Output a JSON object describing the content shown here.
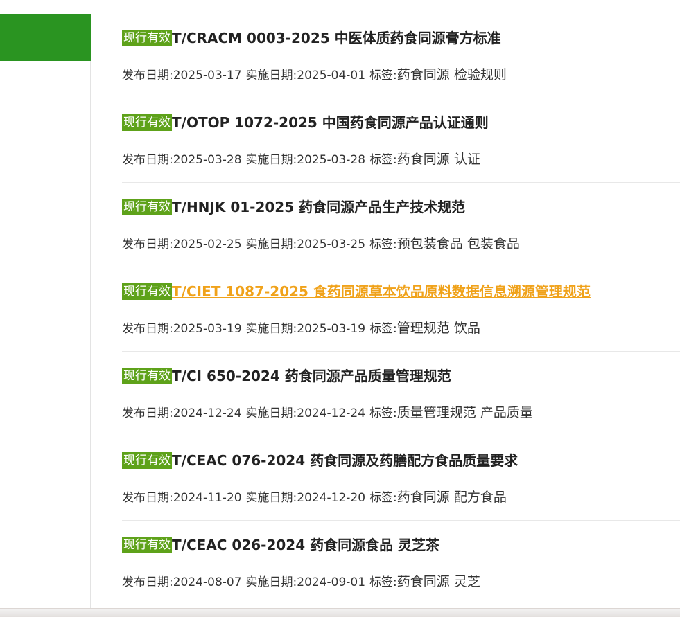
{
  "badge_label": "现行有效",
  "items": [
    {
      "title": "T/CRACM 0003-2025 中医体质药食同源膏方标准",
      "publish_label": "发布日期:",
      "publish_date": "2025-03-17",
      "impl_label": "实施日期:",
      "impl_date": "2025-04-01",
      "tags_label": "标签:",
      "tags": "药食同源 检验规则"
    },
    {
      "title": "T/OTOP 1072-2025 中国药食同源产品认证通则",
      "publish_label": "发布日期:",
      "publish_date": "2025-03-28",
      "impl_label": "实施日期:",
      "impl_date": "2025-03-28",
      "tags_label": "标签:",
      "tags": "药食同源 认证"
    },
    {
      "title": "T/HNJK 01-2025 药食同源产品生产技术规范",
      "publish_label": "发布日期:",
      "publish_date": "2025-02-25",
      "impl_label": "实施日期:",
      "impl_date": "2025-03-25",
      "tags_label": "标签:",
      "tags": "预包装食品 包装食品"
    },
    {
      "title": "T/CIET 1087-2025 食药同源草本饮品原料数据信息溯源管理规范",
      "publish_label": "发布日期:",
      "publish_date": "2025-03-19",
      "impl_label": "实施日期:",
      "impl_date": "2025-03-19",
      "tags_label": "标签:",
      "tags": "管理规范 饮品"
    },
    {
      "title": "T/CI 650-2024 药食同源产品质量管理规范",
      "publish_label": "发布日期:",
      "publish_date": "2024-12-24",
      "impl_label": "实施日期:",
      "impl_date": "2024-12-24",
      "tags_label": "标签:",
      "tags": "质量管理规范 产品质量"
    },
    {
      "title": "T/CEAC 076-2024 药食同源及药膳配方食品质量要求",
      "publish_label": "发布日期:",
      "publish_date": "2024-11-20",
      "impl_label": "实施日期:",
      "impl_date": "2024-12-20",
      "tags_label": "标签:",
      "tags": "药食同源 配方食品"
    },
    {
      "title": "T/CEAC 026-2024 药食同源食品 灵芝茶",
      "publish_label": "发布日期:",
      "publish_date": "2024-08-07",
      "impl_label": "实施日期:",
      "impl_date": "2024-09-01",
      "tags_label": "标签:",
      "tags": "药食同源 灵芝"
    }
  ],
  "colors": {
    "sidebar_green": "#2a9421",
    "badge_green": "#5ea21a",
    "link_hover_orange": "#f0a21a"
  }
}
